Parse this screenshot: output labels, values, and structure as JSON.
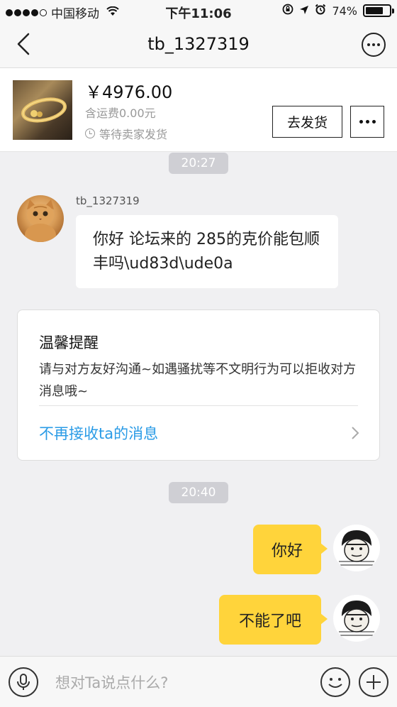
{
  "status_bar": {
    "carrier": "中国移动",
    "time": "下午11:06",
    "battery": "74%",
    "battery_level": 0.74
  },
  "nav": {
    "title": "tb_1327319"
  },
  "order": {
    "price": "￥4976.00",
    "shipping": "含运费0.00元",
    "status": "等待卖家发货",
    "ship_button": "去发货"
  },
  "messages": {
    "time_1": "20:27",
    "sender_name": "tb_1327319",
    "incoming_text": "你好 论坛来的 285的克价能包顺丰吗\\ud83d\\ude0a",
    "time_2": "20:40",
    "outgoing_1": "你好",
    "outgoing_2": "不能了吧"
  },
  "tip": {
    "title": "温馨提醒",
    "body": "请与对方友好沟通~如遇骚扰等不文明行为可以拒收对方消息哦~",
    "link": "不再接收ta的消息"
  },
  "input": {
    "placeholder": "想对Ta说点什么?"
  },
  "colors": {
    "accent_yellow": "#ffd43b",
    "link_blue": "#2a9be6",
    "background": "#f0f0f2"
  },
  "icons": [
    "signal-icon",
    "wifi-icon",
    "lock-rotation-icon",
    "location-icon",
    "alarm-icon",
    "battery-icon",
    "back-icon",
    "more-icon",
    "clock-icon",
    "chevron-right-icon",
    "microphone-icon",
    "emoji-icon",
    "plus-icon"
  ]
}
